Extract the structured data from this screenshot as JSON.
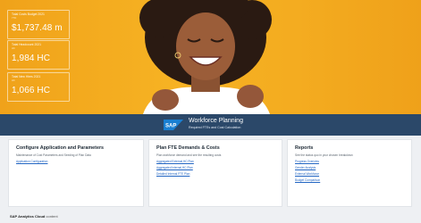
{
  "kpis": [
    {
      "label": "Total Costs Budget 2021",
      "sub": "YTD",
      "value": "$1,737.48 m"
    },
    {
      "label": "Total Headcount 2021",
      "sub": "HC",
      "value": "1,984 HC"
    },
    {
      "label": "Total New Hires 2021",
      "sub": "HC",
      "value": "1,066 HC"
    }
  ],
  "banner": {
    "logo_text": "SAP",
    "title": "Workforce Planning",
    "subtitle": "Required FTEs and Cost Calculation"
  },
  "cards": {
    "configure": {
      "title": "Configure Application and Parameters",
      "desc": "Maintenance of Cost Parameters and Seeding of Plan Data",
      "links": [
        "Application Configuration"
      ]
    },
    "plan": {
      "title": "Plan FTE Demands & Costs",
      "desc": "Plan workforce demand and see the resulting costs",
      "links": [
        "Aggregated External HC Plan",
        "Aggregated Internal HC Plan",
        "Detailed Internal FTE Plan"
      ]
    },
    "reports": {
      "title": "Reports",
      "desc": "See the status quo in your chosen breakdown",
      "links": [
        "Progress Overview",
        "Gender Analysis",
        "External Workforce",
        "Budget Comparison"
      ]
    }
  },
  "footer": {
    "brand": "SAP Analytics Cloud",
    "suffix": "content"
  },
  "colors": {
    "hero": "#f4ac20",
    "band": "#2b4869",
    "link": "#2366c3"
  }
}
